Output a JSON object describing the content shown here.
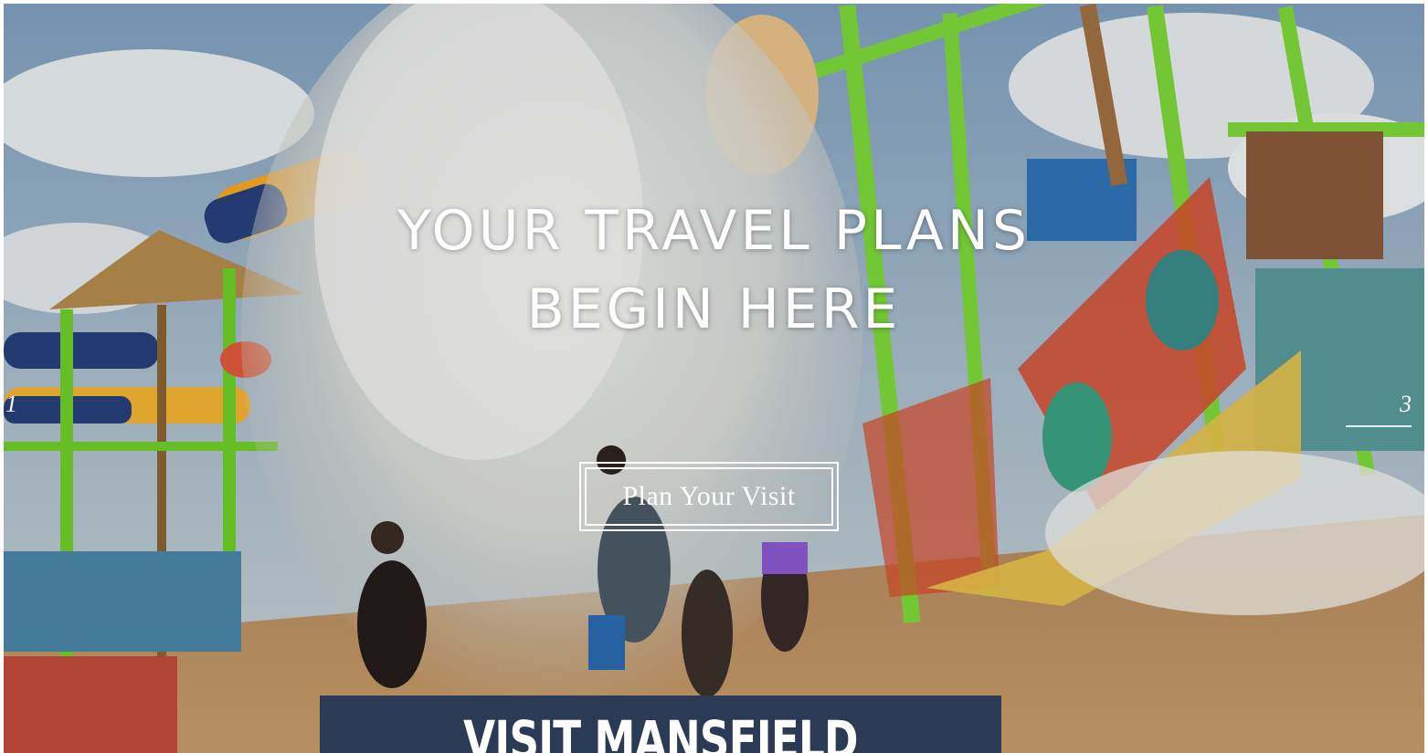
{
  "hero": {
    "headline_line1": "YOUR TRAVEL PLANS",
    "headline_line2": "BEGIN HERE",
    "cta_label": "Plan Your Visit",
    "slide_current": "1",
    "slide_total": "3"
  },
  "banner": {
    "label": "VISIT MANSFIELD"
  },
  "colors": {
    "banner_bg": "#2b3a55",
    "headline_text": "#ffffff",
    "accent_green": "#6fcf2a"
  }
}
